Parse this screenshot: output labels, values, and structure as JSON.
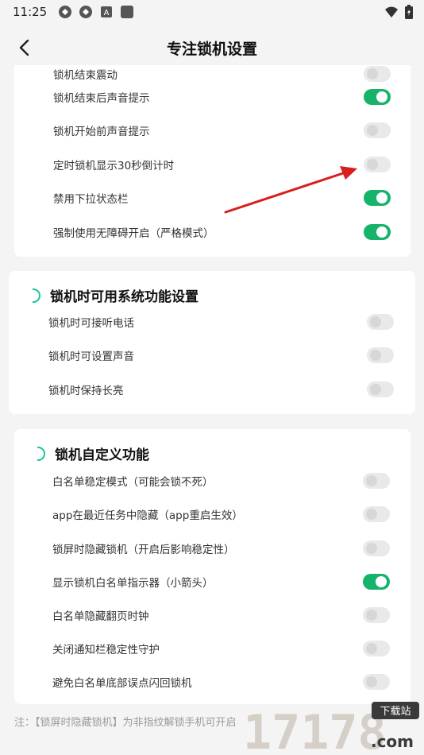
{
  "status_bar": {
    "time": "11:25",
    "icons": [
      "app-icon-1",
      "app-icon-2",
      "app-icon-a",
      "app-icon-square"
    ],
    "right_icons": [
      "wifi-icon",
      "battery-icon"
    ]
  },
  "nav": {
    "title": "专注锁机设置",
    "back_icon": "chevron-left-icon"
  },
  "colors": {
    "accent": "#17b36b",
    "section_accent": "#17c49a",
    "toggle_off": "#e9e9e9"
  },
  "card1": {
    "rows": [
      {
        "label": "锁机结束震动",
        "on": false
      },
      {
        "label": "锁机结束后声音提示",
        "on": true
      },
      {
        "label": "锁机开始前声音提示",
        "on": false
      },
      {
        "label": "定时锁机显示30秒倒计时",
        "on": false
      },
      {
        "label": "禁用下拉状态栏",
        "on": true
      },
      {
        "label": "强制使用无障碍开启（严格模式）",
        "on": true
      }
    ]
  },
  "card2": {
    "title": "锁机时可用系统功能设置",
    "rows": [
      {
        "label": "锁机时可接听电话",
        "on": false
      },
      {
        "label": "锁机时可设置声音",
        "on": false
      },
      {
        "label": "锁机时保持长亮",
        "on": false
      }
    ]
  },
  "card3": {
    "title": "锁机自定义功能",
    "rows": [
      {
        "label": "白名单稳定模式（可能会锁不死）",
        "on": false
      },
      {
        "label": "app在最近任务中隐藏（app重启生效）",
        "on": false
      },
      {
        "label": "锁屏时隐藏锁机（开启后影响稳定性）",
        "on": false
      },
      {
        "label": "显示锁机白名单指示器（小箭头）",
        "on": true
      },
      {
        "label": "白名单隐藏翻页时钟",
        "on": false
      },
      {
        "label": "关闭通知栏稳定性守护",
        "on": false
      },
      {
        "label": "避免白名单底部误点闪回锁机",
        "on": false
      }
    ]
  },
  "footnote": "注：【锁屏时隐藏锁机】为非指纹解锁手机可开启",
  "watermark": {
    "number": "17178",
    "badge": "下载站",
    "suffix": ".com"
  }
}
